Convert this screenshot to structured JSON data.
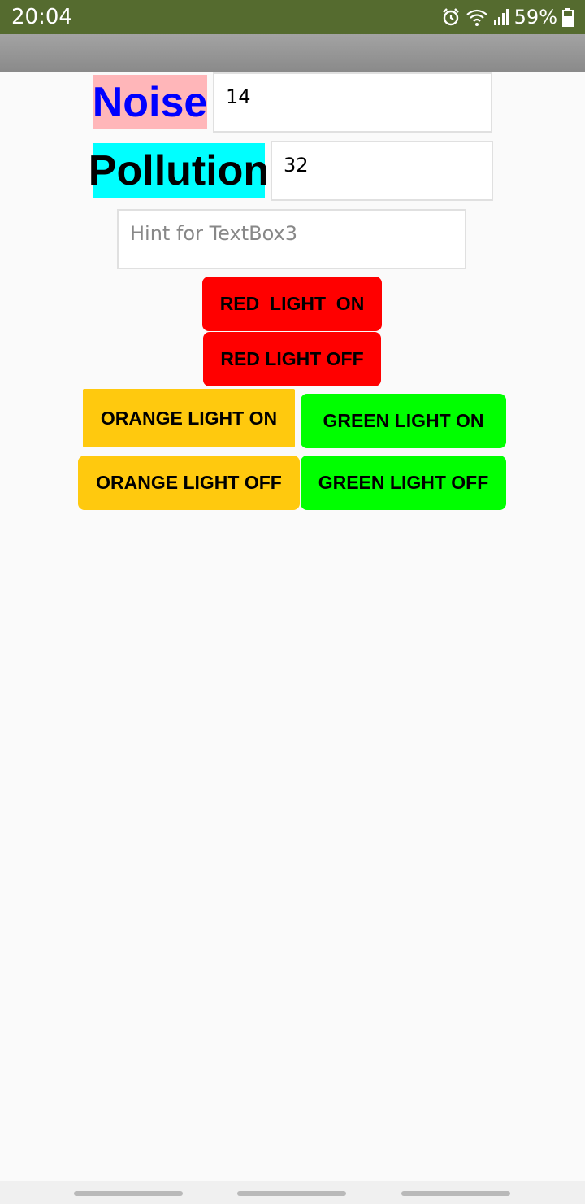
{
  "status_bar": {
    "time": "20:04",
    "battery_percent": "59%",
    "icons": [
      "alarm-icon",
      "wifi-icon",
      "signal-icon",
      "battery-icon"
    ]
  },
  "labels": {
    "noise": "Noise",
    "pollution": "Pollution"
  },
  "inputs": {
    "noise_value": "14",
    "pollution_value": "32",
    "textbox3_placeholder": "Hint for TextBox3"
  },
  "buttons": {
    "red_on": "RED  LIGHT  ON",
    "red_off": "RED LIGHT OFF",
    "orange_on": "ORANGE LIGHT ON",
    "green_on": "GREEN LIGHT ON",
    "orange_off": "ORANGE LIGHT OFF",
    "green_off": "GREEN LIGHT OFF"
  },
  "colors": {
    "status_bar": "#556b2f",
    "noise_label_bg": "#ffb6b9",
    "noise_label_text": "#0000ff",
    "pollution_label_bg": "#00ffff",
    "red": "#ff0000",
    "orange": "#ffc90e",
    "green": "#00ff00"
  }
}
